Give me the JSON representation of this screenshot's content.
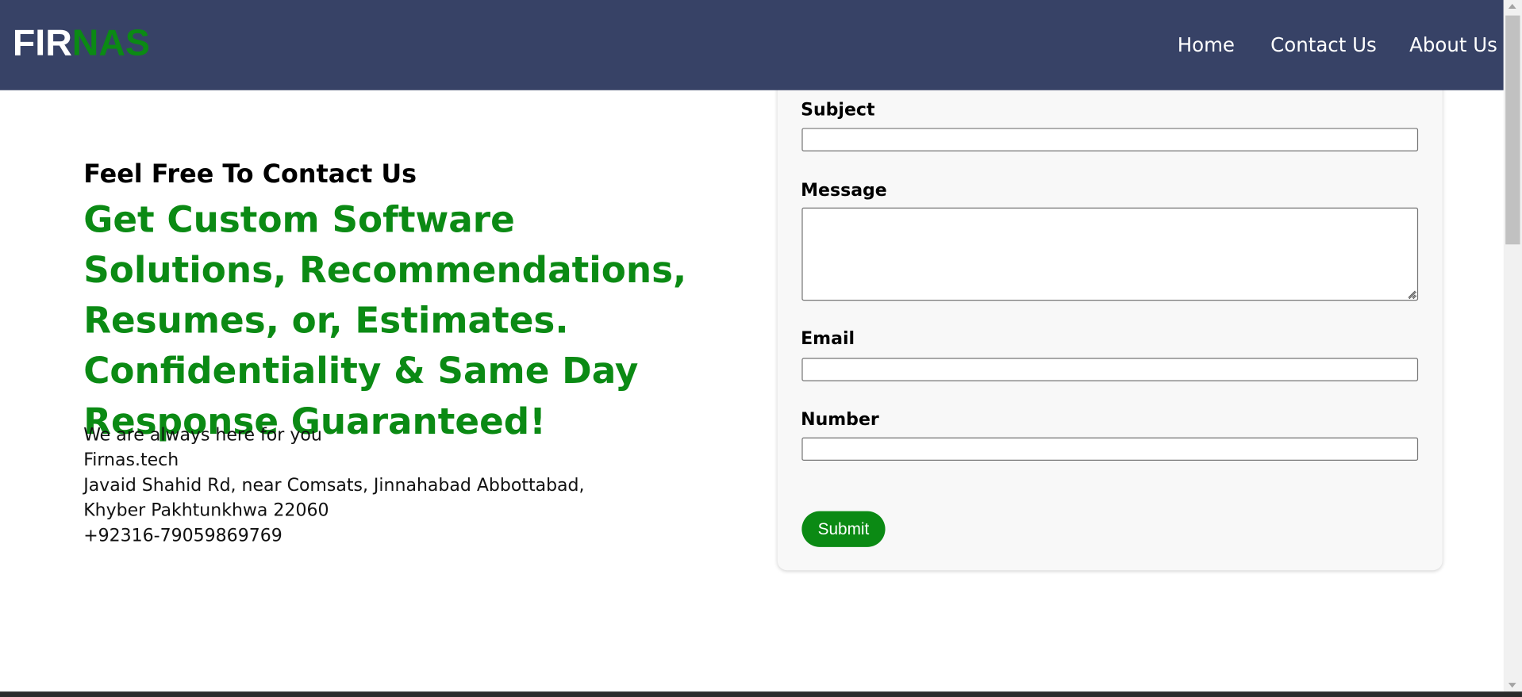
{
  "navbar": {
    "logo_part1": "FIR",
    "logo_part2": "NAS",
    "links": [
      "Home",
      "Contact Us",
      "About Us"
    ]
  },
  "contact": {
    "tagline": "Feel Free To Contact Us",
    "headline": "Get Custom Software Solutions, Recommendations, Resumes, or, Estimates. Confidentiality & Same Day Response Guaranteed!",
    "info_lines": [
      "We are always here for you",
      "Firnas.tech",
      "Javaid Shahid Rd, near Comsats, Jinnahabad Abbottabad,",
      "Khyber Pakhtunkhwa 22060",
      "+92316-79059869769"
    ]
  },
  "form": {
    "subject_label": "Subject",
    "subject_value": "",
    "message_label": "Message",
    "message_value": "",
    "email_label": "Email",
    "email_value": "",
    "number_label": "Number",
    "number_value": "",
    "submit_label": "Submit"
  },
  "colors": {
    "navbar_bg": "#374266",
    "brand_green": "#0b8a14",
    "card_bg": "#f8f8f8"
  }
}
